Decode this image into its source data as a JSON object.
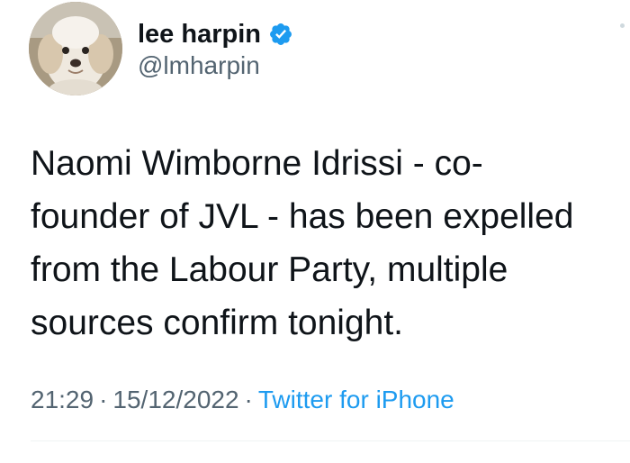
{
  "author": {
    "display_name": "lee harpin",
    "handle": "@lmharpin",
    "verified": true
  },
  "tweet": {
    "text": "Naomi Wimborne Idrissi - co-\nfounder of JVL - has been expelled\nfrom the Labour Party, multiple\nsources confirm tonight.",
    "time": "21:29",
    "date": "15/12/2022",
    "source": "Twitter for iPhone",
    "separator": "·"
  },
  "colors": {
    "text": "#0f1419",
    "secondary": "#536471",
    "link": "#1d9bf0",
    "verified": "#1d9bf0"
  },
  "icons": {
    "verified": "verified-badge-icon",
    "more": "more-options-icon"
  }
}
